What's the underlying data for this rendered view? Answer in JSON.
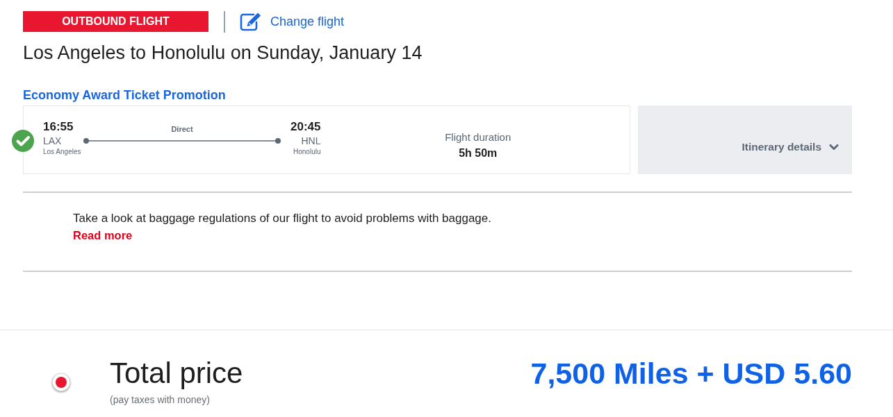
{
  "header": {
    "badge": "OUTBOUND FLIGHT",
    "change_link": "Change flight"
  },
  "title": "Los Angeles to Honolulu on Sunday, January 14",
  "fare_name": "Economy Award Ticket Promotion",
  "flight": {
    "selected": true,
    "departure": {
      "time": "16:55",
      "code": "LAX",
      "city": "Los Angeles"
    },
    "stops": "Direct",
    "arrival": {
      "time": "20:45",
      "code": "HNL",
      "city": "Honolulu"
    },
    "duration_label": "Flight duration",
    "duration": "5h 50m"
  },
  "itinerary": {
    "label": "Itinerary details",
    "expanded": false
  },
  "baggage": {
    "text": "Take a look at baggage regulations of our flight to avoid problems with baggage.",
    "link": "Read more"
  },
  "total": {
    "selected": true,
    "label": "Total price",
    "note": "(pay taxes with money)",
    "price": "7,500 Miles + USD 5.60"
  }
}
